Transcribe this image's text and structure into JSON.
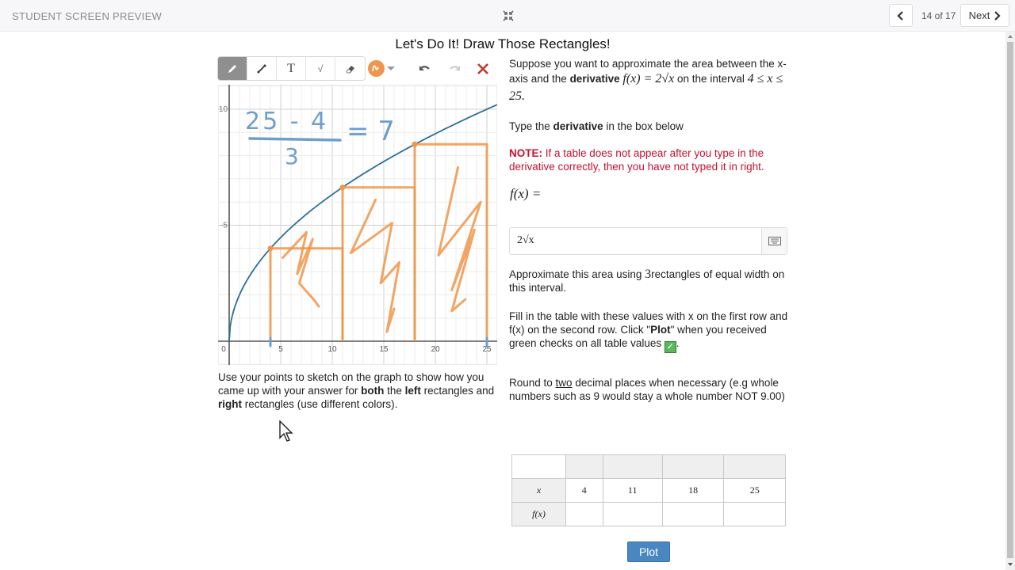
{
  "topbar": {
    "title": "STUDENT SCREEN PREVIEW",
    "page_indicator": "14 of 17",
    "next_label": "Next",
    "collapse_icon": "collapse-arrows-icon",
    "prev_icon": "chevron-left-icon",
    "next_icon": "chevron-right-icon"
  },
  "heading": "Let's Do It! Draw Those Rectangles!",
  "toolbar": {
    "tools": [
      {
        "name": "pencil",
        "icon": "pencil-icon",
        "active": true
      },
      {
        "name": "line",
        "icon": "line-icon",
        "active": false
      },
      {
        "name": "text",
        "icon": "text-icon",
        "label": "T",
        "active": false
      },
      {
        "name": "math",
        "icon": "sqrt-icon",
        "label": "√",
        "active": false
      },
      {
        "name": "eraser",
        "icon": "eraser-icon",
        "active": false
      }
    ],
    "selected_color": "#f0954a",
    "undo_icon": "undo-icon",
    "redo_icon": "redo-icon",
    "clear_icon": "close-icon"
  },
  "graph": {
    "function": "f(x) = 2*sqrt(x)",
    "curve_color": "#2d6e99",
    "x_ticks": [
      "0",
      "5",
      "10",
      "15",
      "20",
      "25"
    ],
    "y_ticks": [
      "-5",
      "-10"
    ],
    "x_range": [
      -0.5,
      26
    ],
    "y_range": [
      -1,
      11
    ],
    "sketch": {
      "handwritten_note": "(25 - 4) / 3 = 7",
      "note_color": "#6f9dcc",
      "rectangle_color": "#f0954a",
      "rectangles": [
        {
          "x0": 4,
          "x1": 11,
          "height": 4
        },
        {
          "x0": 11,
          "x1": 18,
          "height": 6.63
        },
        {
          "x0": 18,
          "x1": 25,
          "height": 8.49
        }
      ]
    }
  },
  "caption": {
    "part1": "Use your points to sketch on the graph to show how you came up with your answer for ",
    "both": "both",
    "part2": " the ",
    "left": "left",
    "part3": " rectangles and ",
    "right": "right",
    "part4": " rectangles (use different colors)."
  },
  "right": {
    "p1_a": "Suppose you want to approximate the area between the x-axis and the ",
    "p1_bold": "derivative",
    "p1_func": "f(x) = 2√x",
    "p1_b": " on the interval ",
    "p1_interval": "4 ≤ x ≤ 25.",
    "p2_a": "Type the ",
    "p2_bold": "derivative",
    "p2_b": " in the box below",
    "note_bold": "NOTE:",
    "note_text": " If a table does not appear after you type in the derivative correctly, then you have not typed it in right.",
    "fx_label": "f(x) =",
    "answer_value": "2√x",
    "keyboard_icon": "keyboard-icon",
    "p3_a": "Approximate this area using ",
    "p3_n": "3",
    "p3_b": "rectangles of equal width on this interval.",
    "p4_a": "Fill in the table with these values with x on the first row and f(x) on the second row. Click \"",
    "p4_bold": "Plot",
    "p4_b": "\" when you received green checks on all table values ",
    "p4_c": ".",
    "p5_a": "Round to ",
    "p5_u": "two",
    "p5_b": " decimal places when necessary (e.g whole numbers such as 9 would stay a whole number NOT 9.00)"
  },
  "table": {
    "header": [
      "",
      "",
      "",
      ""
    ],
    "row_labels": [
      "x",
      "f(x)"
    ],
    "x_values": [
      "4",
      "11",
      "18",
      "25"
    ],
    "fx_values": [
      "",
      "",
      "",
      ""
    ]
  },
  "plot_button": "Plot"
}
